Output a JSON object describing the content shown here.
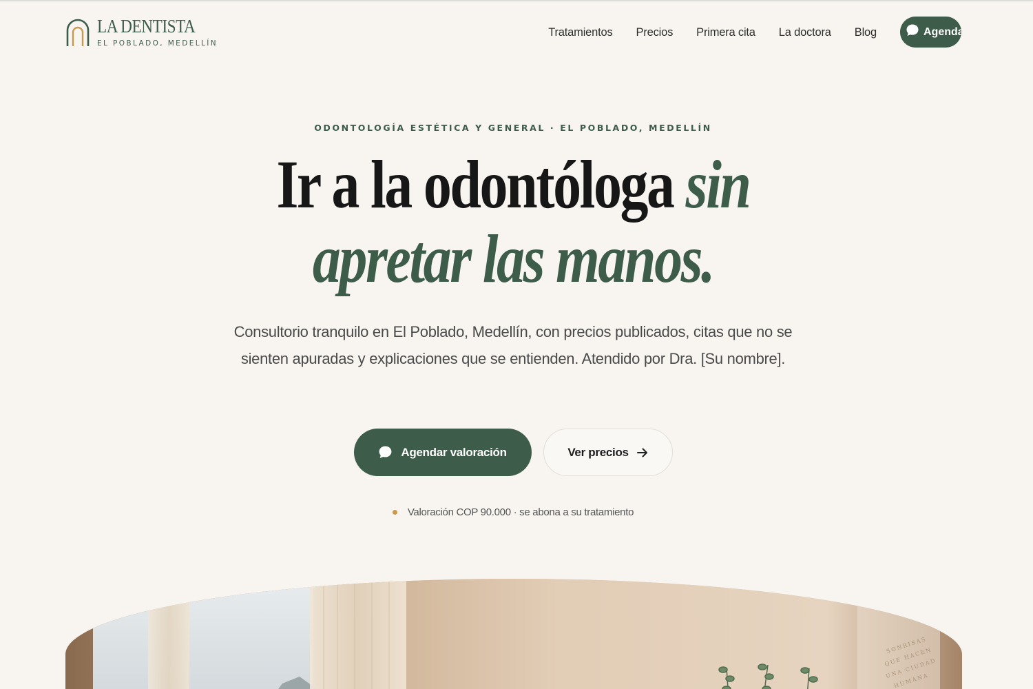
{
  "brand": {
    "name": "LA DENTISTA",
    "location": "EL POBLADO, MEDELLÍN"
  },
  "nav": {
    "items": [
      "Tratamientos",
      "Precios",
      "Primera cita",
      "La doctora",
      "Blog"
    ],
    "cta_label": "Agendar"
  },
  "hero": {
    "eyebrow": "ODONTOLOGÍA ESTÉTICA Y GENERAL · EL POBLADO, MEDELLÍN",
    "headline_plain": "Ir a la odontóloga",
    "headline_accent_1": "sin",
    "headline_accent_2": "apretar las manos.",
    "lede": "Consultorio tranquilo en El Poblado, Medellín, con precios publicados, citas que no se sienten apuradas y explicaciones que se entienden. Atendido por Dra. [Su nombre].",
    "primary_cta": "Agendar valoración",
    "secondary_cta": "Ver precios",
    "note": "Valoración COP 90.000 · se abona a su tratamiento"
  },
  "image_caption": {
    "lines": [
      "SONRISAS",
      "QUE HACEN",
      "UNA CIUDAD",
      "HUMANA"
    ]
  },
  "colors": {
    "background": "#f8f5f0",
    "brand_green": "#3d5c4a",
    "accent_gold": "#c79a4f"
  },
  "icons": {
    "chat": "chat-bubble-icon",
    "arrow": "arrow-right-icon",
    "logo": "arch-logo-icon"
  }
}
